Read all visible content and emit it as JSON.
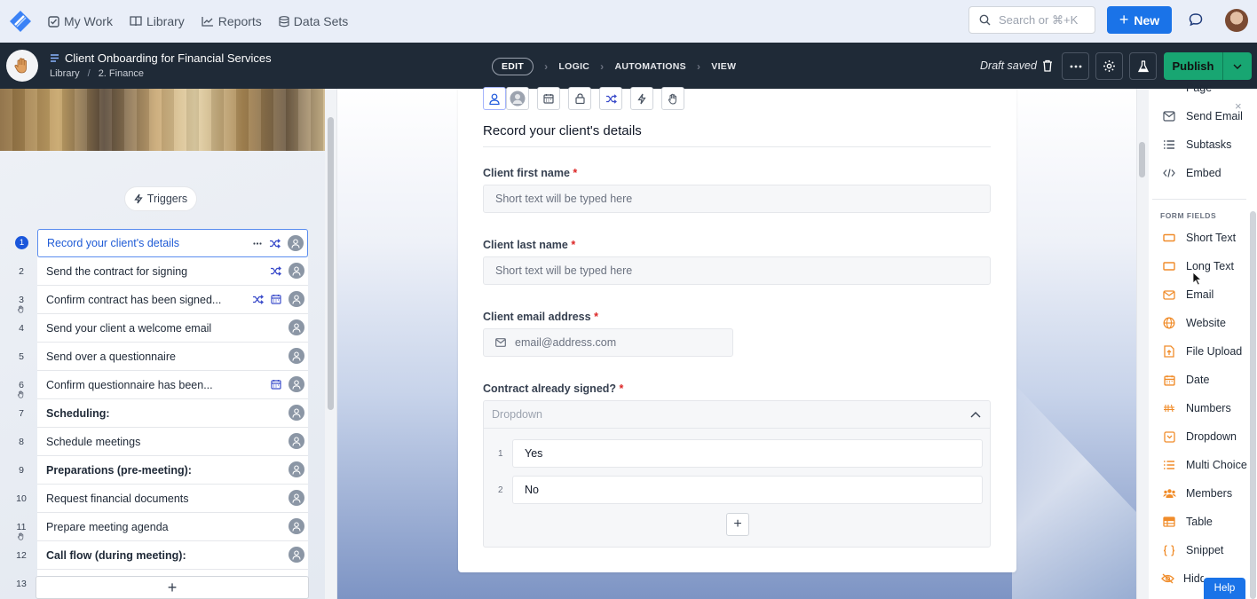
{
  "nav": {
    "my_work": "My Work",
    "library": "Library",
    "reports": "Reports",
    "data_sets": "Data Sets",
    "search_placeholder": "Search or ⌘+K",
    "new_label": "New"
  },
  "header": {
    "workflow_title": "Client Onboarding for Financial Services",
    "breadcrumb": [
      "Library",
      "2. Finance"
    ],
    "modes": [
      "EDIT",
      "LOGIC",
      "AUTOMATIONS",
      "VIEW"
    ],
    "status": "Draft saved",
    "publish_label": "Publish"
  },
  "left": {
    "triggers_label": "Triggers",
    "tasks": [
      {
        "num": "1",
        "label": "Record your client's details",
        "bold": false,
        "active": true,
        "icons": [
          "more",
          "shuffle"
        ],
        "hand": false
      },
      {
        "num": "2",
        "label": "Send the contract for signing",
        "bold": false,
        "icons": [
          "shuffle"
        ],
        "hand": false
      },
      {
        "num": "3",
        "label": "Confirm contract has been signed...",
        "bold": false,
        "icons": [
          "shuffle",
          "calendar"
        ],
        "hand": true
      },
      {
        "num": "4",
        "label": "Send your client a welcome email",
        "bold": false,
        "icons": [],
        "hand": false
      },
      {
        "num": "5",
        "label": "Send over a questionnaire",
        "bold": false,
        "icons": [],
        "hand": false
      },
      {
        "num": "6",
        "label": "Confirm questionnaire has been...",
        "bold": false,
        "icons": [
          "calendar"
        ],
        "hand": true
      },
      {
        "num": "7",
        "label": "Scheduling:",
        "bold": true,
        "icons": [],
        "hand": false
      },
      {
        "num": "8",
        "label": "Schedule meetings",
        "bold": false,
        "icons": [],
        "hand": false
      },
      {
        "num": "9",
        "label": "Preparations (pre-meeting):",
        "bold": true,
        "icons": [],
        "hand": false
      },
      {
        "num": "10",
        "label": "Request financial documents",
        "bold": false,
        "icons": [],
        "hand": false
      },
      {
        "num": "11",
        "label": "Prepare meeting agenda",
        "bold": false,
        "icons": [],
        "hand": true
      },
      {
        "num": "12",
        "label": "Call flow (during meeting):",
        "bold": true,
        "icons": [],
        "hand": false
      },
      {
        "num": "13",
        "label": "",
        "bold": false,
        "icons": [],
        "hand": false
      }
    ],
    "add_label": "+"
  },
  "form": {
    "title": "Record your client's details",
    "fields": [
      {
        "label": "Client first name",
        "placeholder": "Short text will be typed here"
      },
      {
        "label": "Client last name",
        "placeholder": "Short text will be typed here"
      },
      {
        "label": "Client email address",
        "placeholder": "email@address.com"
      },
      {
        "label": "Contract already signed?",
        "placeholder": "Dropdown"
      }
    ],
    "required_mark": "*",
    "options": [
      {
        "num": "1",
        "label": "Yes"
      },
      {
        "num": "2",
        "label": "No"
      }
    ],
    "add_option": "+"
  },
  "right": {
    "top_items": [
      "Page",
      "Send Email",
      "Subtasks",
      "Embed"
    ],
    "section_label": "FORM FIELDS",
    "fields": [
      "Short Text",
      "Long Text",
      "Email",
      "Website",
      "File Upload",
      "Date",
      "Numbers",
      "Dropdown",
      "Multi Choice",
      "Members",
      "Table",
      "Snippet",
      "Hidden"
    ],
    "close": "×",
    "help_label": "Help"
  },
  "colors": {
    "brand_blue": "#1a73e8",
    "header_dark": "#1f2a37",
    "publish_green": "#18a672",
    "field_icon_orange": "#f08c2a"
  }
}
